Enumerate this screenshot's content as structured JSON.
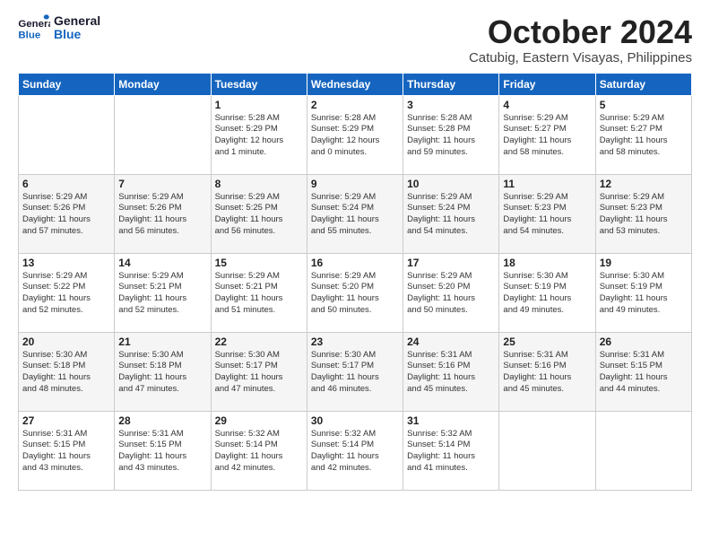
{
  "logo": {
    "line1": "General",
    "line2": "Blue"
  },
  "title": "October 2024",
  "subtitle": "Catubig, Eastern Visayas, Philippines",
  "weekdays": [
    "Sunday",
    "Monday",
    "Tuesday",
    "Wednesday",
    "Thursday",
    "Friday",
    "Saturday"
  ],
  "weeks": [
    [
      {
        "day": "",
        "info": ""
      },
      {
        "day": "",
        "info": ""
      },
      {
        "day": "1",
        "info": "Sunrise: 5:28 AM\nSunset: 5:29 PM\nDaylight: 12 hours\nand 1 minute."
      },
      {
        "day": "2",
        "info": "Sunrise: 5:28 AM\nSunset: 5:29 PM\nDaylight: 12 hours\nand 0 minutes."
      },
      {
        "day": "3",
        "info": "Sunrise: 5:28 AM\nSunset: 5:28 PM\nDaylight: 11 hours\nand 59 minutes."
      },
      {
        "day": "4",
        "info": "Sunrise: 5:29 AM\nSunset: 5:27 PM\nDaylight: 11 hours\nand 58 minutes."
      },
      {
        "day": "5",
        "info": "Sunrise: 5:29 AM\nSunset: 5:27 PM\nDaylight: 11 hours\nand 58 minutes."
      }
    ],
    [
      {
        "day": "6",
        "info": "Sunrise: 5:29 AM\nSunset: 5:26 PM\nDaylight: 11 hours\nand 57 minutes."
      },
      {
        "day": "7",
        "info": "Sunrise: 5:29 AM\nSunset: 5:26 PM\nDaylight: 11 hours\nand 56 minutes."
      },
      {
        "day": "8",
        "info": "Sunrise: 5:29 AM\nSunset: 5:25 PM\nDaylight: 11 hours\nand 56 minutes."
      },
      {
        "day": "9",
        "info": "Sunrise: 5:29 AM\nSunset: 5:24 PM\nDaylight: 11 hours\nand 55 minutes."
      },
      {
        "day": "10",
        "info": "Sunrise: 5:29 AM\nSunset: 5:24 PM\nDaylight: 11 hours\nand 54 minutes."
      },
      {
        "day": "11",
        "info": "Sunrise: 5:29 AM\nSunset: 5:23 PM\nDaylight: 11 hours\nand 54 minutes."
      },
      {
        "day": "12",
        "info": "Sunrise: 5:29 AM\nSunset: 5:23 PM\nDaylight: 11 hours\nand 53 minutes."
      }
    ],
    [
      {
        "day": "13",
        "info": "Sunrise: 5:29 AM\nSunset: 5:22 PM\nDaylight: 11 hours\nand 52 minutes."
      },
      {
        "day": "14",
        "info": "Sunrise: 5:29 AM\nSunset: 5:21 PM\nDaylight: 11 hours\nand 52 minutes."
      },
      {
        "day": "15",
        "info": "Sunrise: 5:29 AM\nSunset: 5:21 PM\nDaylight: 11 hours\nand 51 minutes."
      },
      {
        "day": "16",
        "info": "Sunrise: 5:29 AM\nSunset: 5:20 PM\nDaylight: 11 hours\nand 50 minutes."
      },
      {
        "day": "17",
        "info": "Sunrise: 5:29 AM\nSunset: 5:20 PM\nDaylight: 11 hours\nand 50 minutes."
      },
      {
        "day": "18",
        "info": "Sunrise: 5:30 AM\nSunset: 5:19 PM\nDaylight: 11 hours\nand 49 minutes."
      },
      {
        "day": "19",
        "info": "Sunrise: 5:30 AM\nSunset: 5:19 PM\nDaylight: 11 hours\nand 49 minutes."
      }
    ],
    [
      {
        "day": "20",
        "info": "Sunrise: 5:30 AM\nSunset: 5:18 PM\nDaylight: 11 hours\nand 48 minutes."
      },
      {
        "day": "21",
        "info": "Sunrise: 5:30 AM\nSunset: 5:18 PM\nDaylight: 11 hours\nand 47 minutes."
      },
      {
        "day": "22",
        "info": "Sunrise: 5:30 AM\nSunset: 5:17 PM\nDaylight: 11 hours\nand 47 minutes."
      },
      {
        "day": "23",
        "info": "Sunrise: 5:30 AM\nSunset: 5:17 PM\nDaylight: 11 hours\nand 46 minutes."
      },
      {
        "day": "24",
        "info": "Sunrise: 5:31 AM\nSunset: 5:16 PM\nDaylight: 11 hours\nand 45 minutes."
      },
      {
        "day": "25",
        "info": "Sunrise: 5:31 AM\nSunset: 5:16 PM\nDaylight: 11 hours\nand 45 minutes."
      },
      {
        "day": "26",
        "info": "Sunrise: 5:31 AM\nSunset: 5:15 PM\nDaylight: 11 hours\nand 44 minutes."
      }
    ],
    [
      {
        "day": "27",
        "info": "Sunrise: 5:31 AM\nSunset: 5:15 PM\nDaylight: 11 hours\nand 43 minutes."
      },
      {
        "day": "28",
        "info": "Sunrise: 5:31 AM\nSunset: 5:15 PM\nDaylight: 11 hours\nand 43 minutes."
      },
      {
        "day": "29",
        "info": "Sunrise: 5:32 AM\nSunset: 5:14 PM\nDaylight: 11 hours\nand 42 minutes."
      },
      {
        "day": "30",
        "info": "Sunrise: 5:32 AM\nSunset: 5:14 PM\nDaylight: 11 hours\nand 42 minutes."
      },
      {
        "day": "31",
        "info": "Sunrise: 5:32 AM\nSunset: 5:14 PM\nDaylight: 11 hours\nand 41 minutes."
      },
      {
        "day": "",
        "info": ""
      },
      {
        "day": "",
        "info": ""
      }
    ]
  ]
}
